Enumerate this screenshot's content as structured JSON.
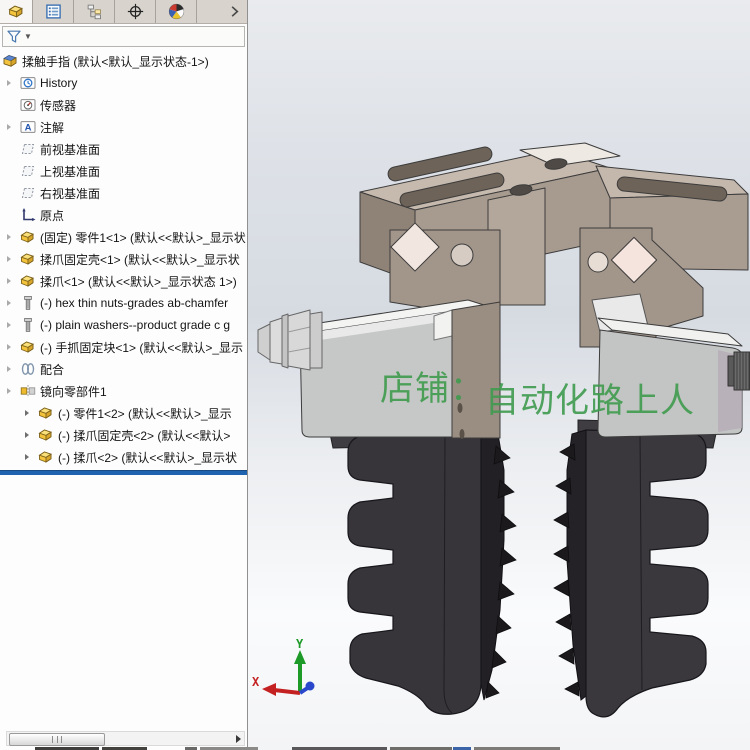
{
  "panel": {
    "tabs": [
      {
        "id": "featuremanager",
        "icon": "part",
        "active": true
      },
      {
        "id": "propertymanager",
        "icon": "list",
        "active": false
      },
      {
        "id": "configurationmanager",
        "icon": "config",
        "active": false
      },
      {
        "id": "dimxpertmanager",
        "icon": "crosshair",
        "active": false
      },
      {
        "id": "displaymanager",
        "icon": "colorwheel",
        "active": false
      }
    ],
    "overflow_icon": "chevron-right",
    "filter_icon": "filter",
    "tree": [
      {
        "id": "root",
        "label": "揉触手指  (默认<默认_显示状态-1>)",
        "icon": "assembly",
        "level": 0,
        "arrow": false
      },
      {
        "id": "history",
        "label": "History",
        "icon": "history",
        "level": 1,
        "arrow": true
      },
      {
        "id": "sensors",
        "label": "传感器",
        "icon": "sensors",
        "level": 1,
        "arrow": false
      },
      {
        "id": "annotations",
        "label": "注解",
        "icon": "annotations",
        "level": 1,
        "arrow": true
      },
      {
        "id": "front-plane",
        "label": "前视基准面",
        "icon": "plane",
        "level": 1,
        "arrow": false
      },
      {
        "id": "top-plane",
        "label": "上视基准面",
        "icon": "plane",
        "level": 1,
        "arrow": false
      },
      {
        "id": "right-plane",
        "label": "右视基准面",
        "icon": "plane",
        "level": 1,
        "arrow": false
      },
      {
        "id": "origin",
        "label": "原点",
        "icon": "origin",
        "level": 1,
        "arrow": false
      },
      {
        "id": "part1-1",
        "label": "(固定) 零件1<1> (默认<<默认>_显示状",
        "icon": "part",
        "level": 1,
        "arrow": true
      },
      {
        "id": "claw-shell-1",
        "label": "揉爪固定壳<1> (默认<<默认>_显示状",
        "icon": "part",
        "level": 1,
        "arrow": true
      },
      {
        "id": "claw-1",
        "label": "揉爪<1> (默认<<默认>_显示状态 1>)",
        "icon": "part",
        "level": 1,
        "arrow": true
      },
      {
        "id": "hex-nuts",
        "label": "(-) hex thin nuts-grades ab-chamfer",
        "icon": "fastener",
        "level": 1,
        "arrow": true
      },
      {
        "id": "washers",
        "label": "(-) plain washers--product grade c g",
        "icon": "fastener",
        "level": 1,
        "arrow": true
      },
      {
        "id": "grab-block",
        "label": "(-) 手抓固定块<1> (默认<<默认>_显示",
        "icon": "part",
        "level": 1,
        "arrow": true
      },
      {
        "id": "mates",
        "label": "配合",
        "icon": "mates",
        "level": 1,
        "arrow": true
      },
      {
        "id": "mirror-comp",
        "label": "镜向零部件1",
        "icon": "mirror",
        "level": 1,
        "arrow": true
      },
      {
        "id": "part1-2",
        "label": "(-) 零件1<2> (默认<<默认>_显示",
        "icon": "part",
        "level": 2,
        "arrow": true
      },
      {
        "id": "claw-shell-2",
        "label": "(-) 揉爪固定壳<2> (默认<<默认>",
        "icon": "part",
        "level": 2,
        "arrow": true
      },
      {
        "id": "claw-2",
        "label": "(-) 揉爪<2> (默认<<默认>_显示状",
        "icon": "part",
        "level": 2,
        "arrow": true
      }
    ]
  },
  "viewport": {
    "watermark_part1": "店铺：",
    "watermark_part2": "自动化路上人",
    "triad": {
      "x_label": "X",
      "y_label": "Y"
    },
    "colors": {
      "watermark": "#3f9b4e",
      "rollback_bar": "#1e62b0",
      "axis_x": "#c42222",
      "axis_y": "#1d9a28",
      "axis_z": "#2a48cc",
      "plate": "#a99c91",
      "bracket": "#a2958a",
      "actuator": "#c6c8c7",
      "finger": "#37353a"
    }
  }
}
